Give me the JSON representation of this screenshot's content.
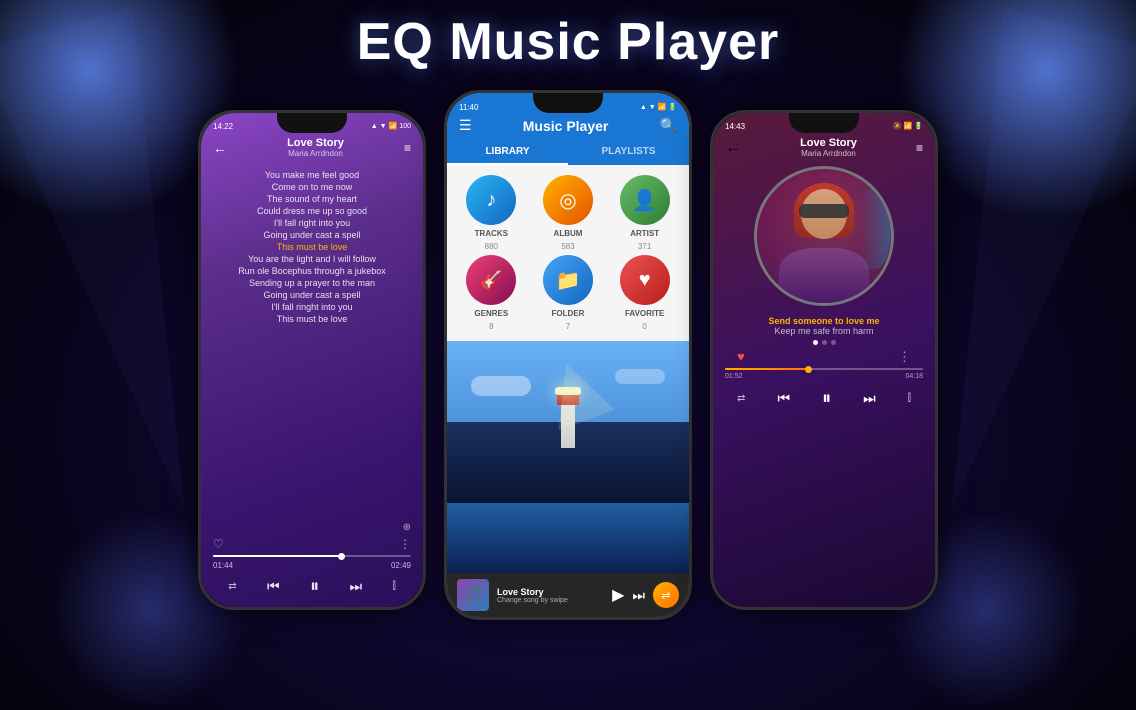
{
  "app": {
    "title": "EQ Music Player"
  },
  "phone_left": {
    "status": {
      "time": "14:22",
      "battery": "100"
    },
    "header": {
      "back": "←",
      "song_title": "Love Story",
      "song_artist": "Maria Arrdndon",
      "queue": "≡"
    },
    "lyrics": [
      {
        "text": "You make me feel good",
        "highlight": false
      },
      {
        "text": "Come on to me now",
        "highlight": false
      },
      {
        "text": "The sound of my heart",
        "highlight": false
      },
      {
        "text": "Could dress me up so good",
        "highlight": false
      },
      {
        "text": "I'll fall right into you",
        "highlight": false
      },
      {
        "text": "Going under cast a spell",
        "highlight": false
      },
      {
        "text": "This must be love",
        "highlight": true
      },
      {
        "text": "You are the light and I will follow",
        "highlight": false
      },
      {
        "text": "Run ole Bocephus through a jukebox",
        "highlight": false
      },
      {
        "text": "Sending up a prayer to the man",
        "highlight": false
      },
      {
        "text": "Going under cast a spell",
        "highlight": false
      },
      {
        "text": "I'll fall ringht into you",
        "highlight": false
      },
      {
        "text": "This must be love",
        "highlight": false
      }
    ],
    "progress": {
      "current": "01:44",
      "total": "02:49",
      "fill_pct": 65
    }
  },
  "phone_center": {
    "status": {
      "time": "11:40"
    },
    "header": {
      "menu": "☰",
      "title": "Music Player",
      "search": "🔍"
    },
    "tabs": [
      {
        "label": "LIBRARY",
        "active": true
      },
      {
        "label": "PLAYLISTS",
        "active": false
      }
    ],
    "library_items": [
      {
        "key": "tracks",
        "label": "TRACKS",
        "count": "880",
        "icon": "♪",
        "color_class": "tracks"
      },
      {
        "key": "album",
        "label": "ALBUM",
        "count": "583",
        "icon": "💿",
        "color_class": "album"
      },
      {
        "key": "artist",
        "label": "ARTIST",
        "count": "371",
        "icon": "👤",
        "color_class": "artist"
      },
      {
        "key": "genres",
        "label": "GENRES",
        "count": "8",
        "icon": "🎸",
        "color_class": "genres"
      },
      {
        "key": "folder",
        "label": "FOLDER",
        "count": "7",
        "icon": "📁",
        "color_class": "folder"
      },
      {
        "key": "favorite",
        "label": "FAVORITE",
        "count": "0",
        "icon": "♥",
        "color_class": "favorite"
      }
    ],
    "now_playing": {
      "title": "Love Story",
      "subtitle": "Change song by swipe",
      "play": "▶",
      "next": "⏭"
    }
  },
  "phone_right": {
    "status": {
      "time": "14:43"
    },
    "header": {
      "back": "←",
      "song_title": "Love Story",
      "song_artist": "Maria Arrdndon",
      "queue": "≡"
    },
    "lyrics": [
      {
        "text": "Send someone to love me",
        "highlight": true
      },
      {
        "text": "Keep me safe from harm",
        "highlight": false
      }
    ],
    "progress": {
      "current": "01:52",
      "total": "04:18",
      "fill_pct": 42
    }
  }
}
